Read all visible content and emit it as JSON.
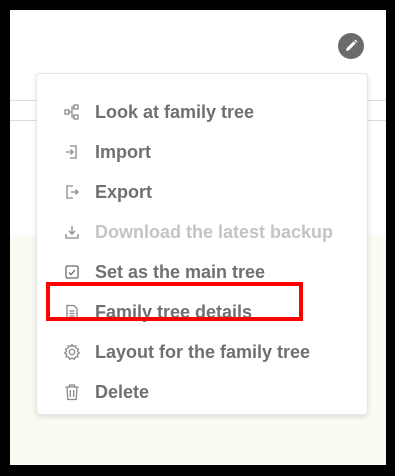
{
  "toolbar": {
    "edit_icon": "pencil-icon"
  },
  "menu": {
    "items": [
      {
        "label": "Look at family tree",
        "icon": "tree-nodes-icon",
        "disabled": false
      },
      {
        "label": "Import",
        "icon": "import-icon",
        "disabled": false
      },
      {
        "label": "Export",
        "icon": "export-icon",
        "disabled": false
      },
      {
        "label": "Download the latest backup",
        "icon": "download-icon",
        "disabled": true
      },
      {
        "label": "Set as the main tree",
        "icon": "checkbox-icon",
        "disabled": false
      },
      {
        "label": "Family tree details",
        "icon": "document-icon",
        "disabled": false,
        "highlighted": true
      },
      {
        "label": "Layout for the family tree",
        "icon": "gear-icon",
        "disabled": false
      },
      {
        "label": "Delete",
        "icon": "trash-icon",
        "disabled": false
      }
    ]
  },
  "colors": {
    "menu_text": "#707070",
    "disabled_text": "#c4c4c4",
    "highlight": "#ff0000",
    "edit_button": "#6b6b6b"
  }
}
